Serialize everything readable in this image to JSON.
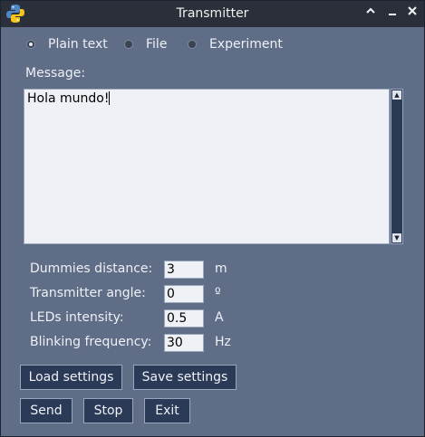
{
  "window": {
    "title": "Transmitter",
    "app_icon": "python-icon",
    "controls": {
      "maximize_icon": "chevron-up-icon",
      "minimize_icon": "minimize-icon",
      "close_icon": "close-icon"
    }
  },
  "mode": {
    "options": [
      "Plain text",
      "File",
      "Experiment"
    ],
    "selected": "Plain text"
  },
  "message": {
    "label": "Message:",
    "value": "Hola mundo!"
  },
  "settings": [
    {
      "label": "Dummies distance:",
      "value": "3",
      "unit": "m"
    },
    {
      "label": "Transmitter angle:",
      "value": "0",
      "unit": "º"
    },
    {
      "label": "LEDs intensity:",
      "value": "0.5",
      "unit": "A"
    },
    {
      "label": "Blinking frequency:",
      "value": "30",
      "unit": "Hz"
    }
  ],
  "buttons": {
    "load_settings": "Load settings",
    "save_settings": "Save settings",
    "send": "Send",
    "stop": "Stop",
    "exit": "Exit"
  },
  "colors": {
    "background": "#5f6d87",
    "titlebar": "#2a2f3a",
    "button": "#2b3a57",
    "field": "#eef1f6"
  }
}
